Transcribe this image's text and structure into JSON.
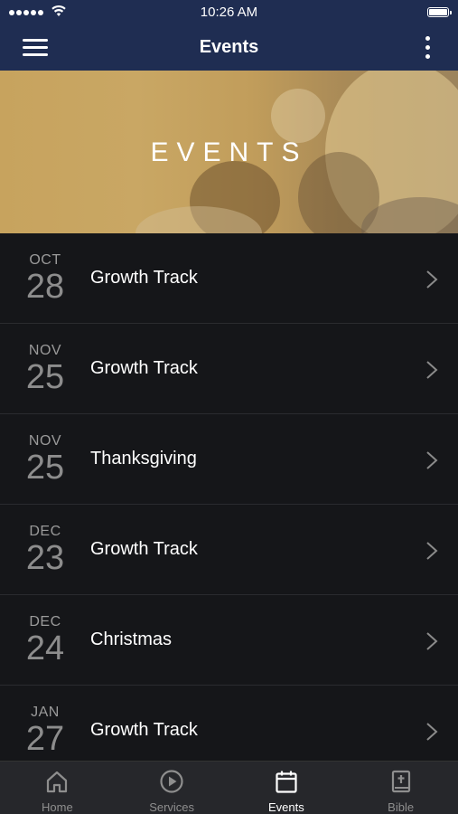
{
  "status_bar": {
    "time": "10:26 AM"
  },
  "nav": {
    "title": "Events"
  },
  "hero": {
    "title": "EVENTS"
  },
  "events": [
    {
      "month": "OCT",
      "day": "28",
      "name": "Growth Track"
    },
    {
      "month": "NOV",
      "day": "25",
      "name": "Growth Track"
    },
    {
      "month": "NOV",
      "day": "25",
      "name": "Thanksgiving"
    },
    {
      "month": "DEC",
      "day": "23",
      "name": "Growth Track"
    },
    {
      "month": "DEC",
      "day": "24",
      "name": "Christmas"
    },
    {
      "month": "JAN",
      "day": "27",
      "name": "Growth Track"
    }
  ],
  "tabs": [
    {
      "label": "Home",
      "icon": "home-icon",
      "active": false
    },
    {
      "label": "Services",
      "icon": "play-circle-icon",
      "active": false
    },
    {
      "label": "Events",
      "icon": "calendar-icon",
      "active": true
    },
    {
      "label": "Bible",
      "icon": "bible-icon",
      "active": false
    }
  ],
  "colors": {
    "nav_bg": "#1f2d52",
    "list_bg": "#151619",
    "hero_tint": "#c7a35e",
    "tab_bg": "#26272b"
  }
}
